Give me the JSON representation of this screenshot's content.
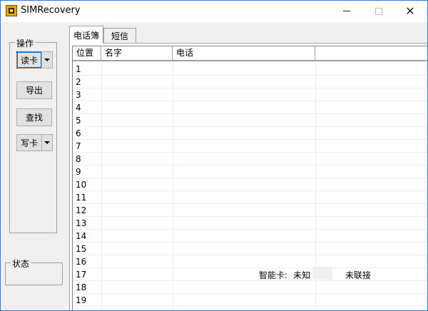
{
  "window": {
    "title": "SIMRecovery",
    "controls": {
      "minimize": "minimize",
      "maximize": "maximize",
      "close": "✕"
    }
  },
  "left_panel": {
    "operations_group_label": "操作",
    "buttons": {
      "read_card": "读卡",
      "export": "导出",
      "find": "查找",
      "write_card": "写卡"
    },
    "status_group_label": "状态"
  },
  "tabs": [
    {
      "label": "电话簿",
      "selected": true
    },
    {
      "label": "短信",
      "selected": false
    }
  ],
  "table": {
    "columns": [
      "位置",
      "名字",
      "电话",
      ""
    ],
    "rows": [
      "1",
      "2",
      "3",
      "4",
      "5",
      "6",
      "7",
      "8",
      "9",
      "10",
      "11",
      "12",
      "13",
      "14",
      "15",
      "16",
      "17",
      "18",
      "19"
    ]
  },
  "status_bar": {
    "smart_card_label": "智能卡:",
    "smart_card_value": "未知",
    "connection_status": "未联接"
  }
}
